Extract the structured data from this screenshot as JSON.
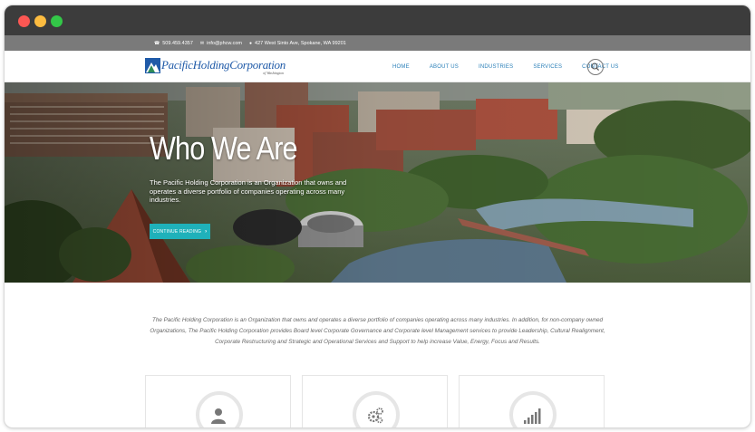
{
  "topbar": {
    "phone": "509.459.4357",
    "email": "info@phcw.com",
    "address": "427 West Sinto Ave, Spokane, WA 99201"
  },
  "logo": {
    "name": "PacificHoldingCorporation",
    "sub": "of Washington"
  },
  "nav": {
    "items": [
      "HOME",
      "ABOUT US",
      "INDUSTRIES",
      "SERVICES",
      "CONTACT US"
    ]
  },
  "hero": {
    "title": "Who We Are",
    "text": "The Pacific Holding Corporation is an Organization that owns and operates a diverse portfolio of companies operating across many industries.",
    "button": "CONTINUE READING"
  },
  "intro": {
    "text": "The Pacific Holding Corporation is an Organization that owns and operates a diverse portfolio of companies operating across many industries. In addition, for non-company owned Organizations, The Pacific Holding Corporation provides Board level Corporate Governance and Corporate level Management services to provide Leadership, Cultural Realignment, Corporate Restructuring and Strategic and Operational Services and Support to help increase Value, Energy, Focus and Results."
  },
  "cards": [
    {
      "icon": "user-icon"
    },
    {
      "icon": "gears-icon"
    },
    {
      "icon": "bar-chart-icon"
    }
  ],
  "colors": {
    "accent": "#1fb1ba",
    "nav_link": "#2a7fb8",
    "logo_blue": "#1f5aa8",
    "logo_green": "#2e8b57",
    "infobar": "#7a7a7a"
  }
}
